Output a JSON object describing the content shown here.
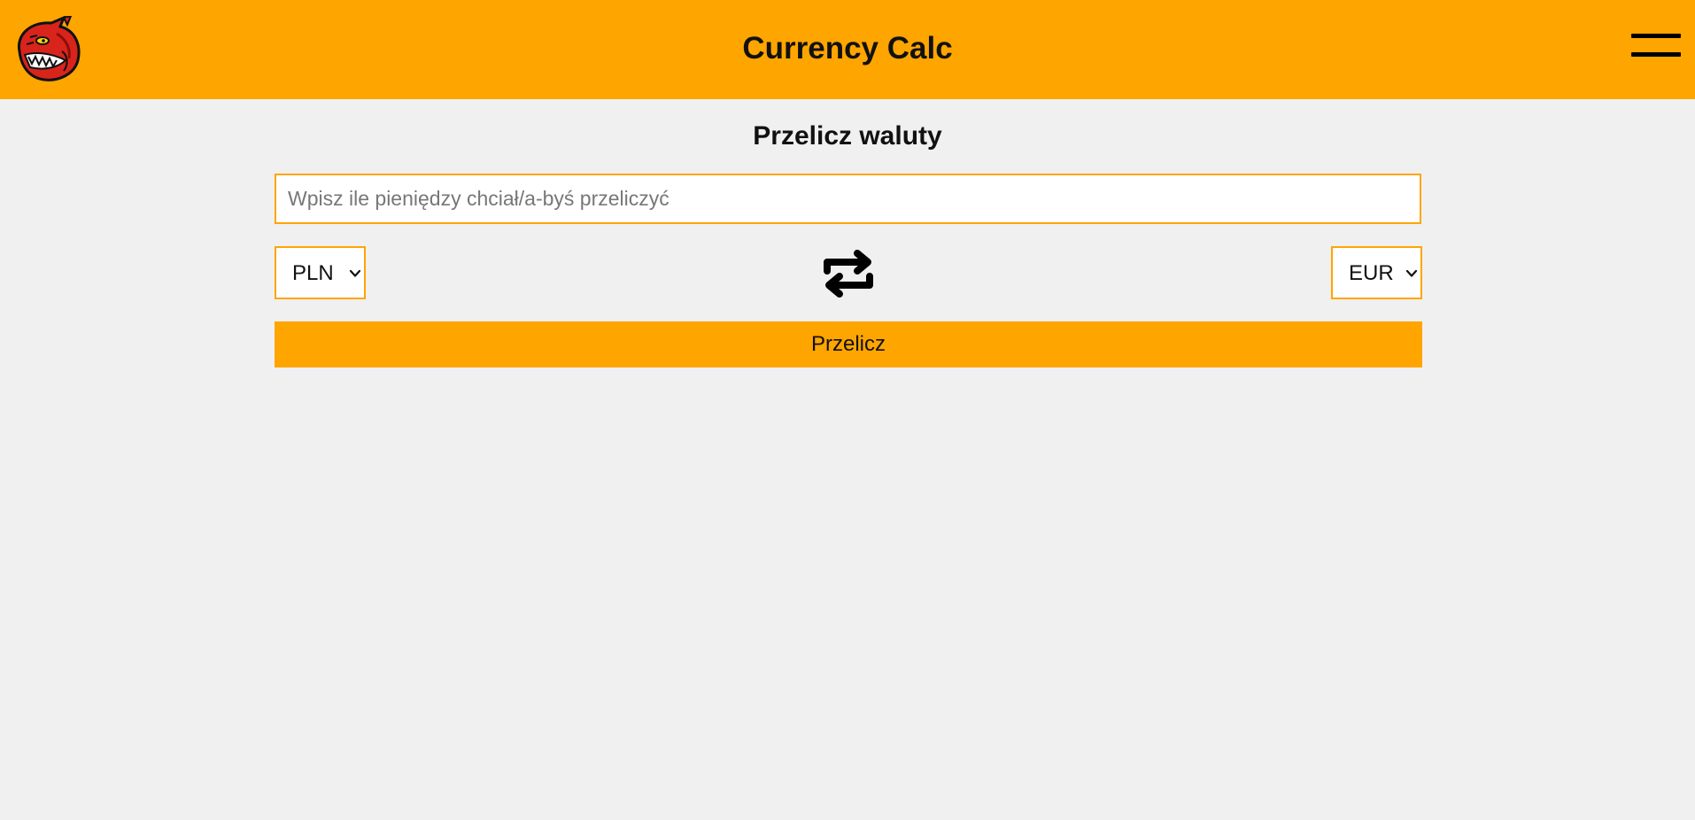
{
  "header": {
    "title": "Currency Calc",
    "logo_icon": "dragon-logo-icon",
    "menu_icon": "hamburger-menu-icon",
    "background_color": "#ffa500"
  },
  "main": {
    "heading": "Przelicz waluty",
    "amount_input": {
      "placeholder": "Wpisz ile pieniędzy chciał/a-byś przeliczyć",
      "value": ""
    },
    "from_currency": "PLN",
    "to_currency": "EUR",
    "swap_icon": "swap-arrows-icon",
    "convert_label": "Przelicz",
    "accent_color": "#ffa500",
    "page_background": "#f0f0f0"
  }
}
